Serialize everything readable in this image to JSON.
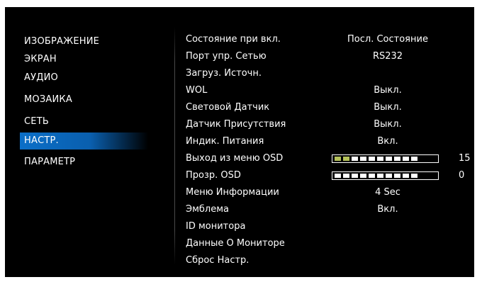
{
  "sidebar": {
    "items": [
      {
        "label": "ИЗОБРАЖЕНИЕ"
      },
      {
        "label": "ЭКРАН"
      },
      {
        "label": "АУДИО"
      },
      {
        "label": "МОЗАИКА"
      },
      {
        "label": "СЕТЬ"
      },
      {
        "label": "НАСТР."
      },
      {
        "label": "ПАРАМЕТР"
      }
    ],
    "selected": "НАСТР.",
    "accent_color": "#0b6fc8"
  },
  "settings": [
    {
      "label": "Состояние при вкл.",
      "value": "Посл. Состояние"
    },
    {
      "label": "Порт упр. Сетью",
      "value": "RS232"
    },
    {
      "label": "Загруз. Источн.",
      "value": ""
    },
    {
      "label": "WOL",
      "value": "Выкл."
    },
    {
      "label": "Световой Датчик",
      "value": "Выкл."
    },
    {
      "label": "Датчик Присутствия",
      "value": "Выкл."
    },
    {
      "label": "Индик. Питания",
      "value": "Вкл."
    },
    {
      "label": "Выход из меню OSD",
      "slider_value": "15",
      "slider_segments_lit": 2,
      "slider_segments_total": 10
    },
    {
      "label": "Прозр. OSD",
      "slider_value": "0",
      "slider_segments_lit": 0,
      "slider_segments_total": 10
    },
    {
      "label": "Меню Информации",
      "value": "4 Sec"
    },
    {
      "label": "Эмблема",
      "value": "Вкл."
    },
    {
      "label": "ID монитора",
      "value": ""
    },
    {
      "label": "Данные О Мониторе",
      "value": ""
    },
    {
      "label": "Сброс Настр.",
      "value": ""
    }
  ],
  "colors": {
    "background": "#000000",
    "text": "#ffffff",
    "slider_lit": "#b5c25a"
  }
}
